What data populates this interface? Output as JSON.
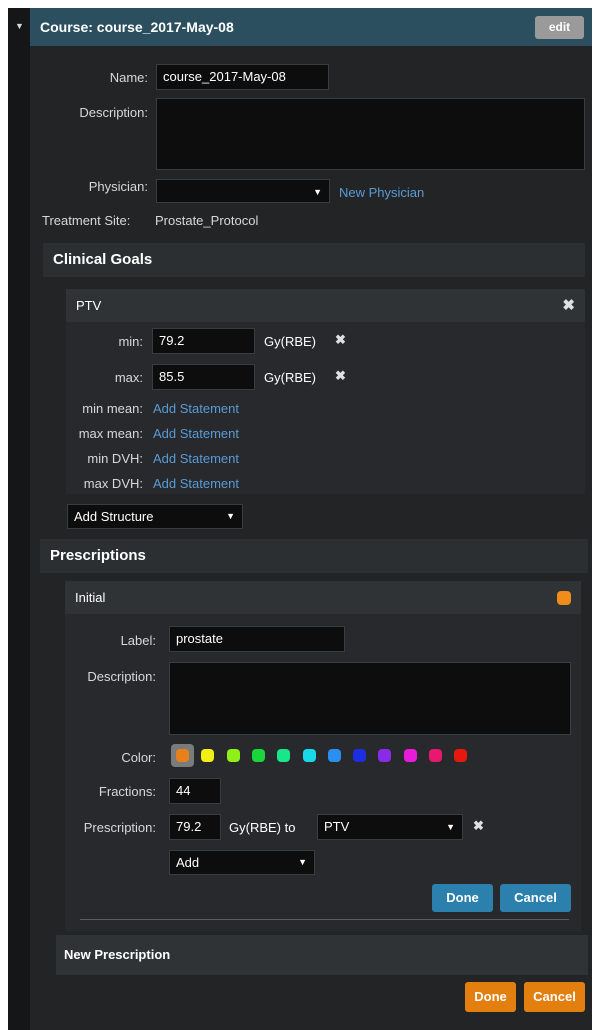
{
  "course": {
    "title": "Course: course_2017-May-08",
    "edit_label": "edit",
    "name_label": "Name:",
    "name_value": "course_2017-May-08",
    "description_label": "Description:",
    "description_value": "",
    "physician_label": "Physician:",
    "physician_value": "",
    "new_physician_link": "New Physician",
    "treatment_site_label": "Treatment Site:",
    "treatment_site_value": "Prostate_Protocol"
  },
  "clinical_goals": {
    "title": "Clinical Goals",
    "structure": {
      "name": "PTV",
      "min_label": "min:",
      "min_value": "79.2",
      "min_unit": "Gy(RBE)",
      "max_label": "max:",
      "max_value": "85.5",
      "max_unit": "Gy(RBE)",
      "statements": [
        {
          "label": "min mean:",
          "link": "Add Statement"
        },
        {
          "label": "max mean:",
          "link": "Add Statement"
        },
        {
          "label": "min DVH:",
          "link": "Add Statement"
        },
        {
          "label": "max DVH:",
          "link": "Add Statement"
        }
      ]
    },
    "add_structure_label": "Add Structure"
  },
  "prescriptions": {
    "title": "Prescriptions",
    "item": {
      "name": "Initial",
      "status_color": "#f08c1a",
      "label_label": "Label:",
      "label_value": "prostate",
      "description_label": "Description:",
      "description_value": "",
      "color_label": "Color:",
      "colors": [
        "#e8801c",
        "#f3ee16",
        "#8ef016",
        "#1bd63a",
        "#17e68a",
        "#19d9e8",
        "#2a8ff0",
        "#1d2ee0",
        "#8a2be8",
        "#e81cd8",
        "#e8186e",
        "#e8180e"
      ],
      "selected_color_index": 0,
      "fractions_label": "Fractions:",
      "fractions_value": "44",
      "prescription_label": "Prescription:",
      "prescription_dose": "79.2",
      "prescription_unit": "Gy(RBE) to",
      "prescription_target": "PTV",
      "add_label": "Add",
      "done_label": "Done",
      "cancel_label": "Cancel"
    },
    "new_prescription_label": "New Prescription"
  },
  "footer": {
    "done_label": "Done",
    "cancel_label": "Cancel"
  },
  "accent_colors": {
    "header": "#2b4f5f",
    "link": "#5a9bd5",
    "primary_button": "#2c80ad",
    "orange_button": "#e37f0f"
  }
}
